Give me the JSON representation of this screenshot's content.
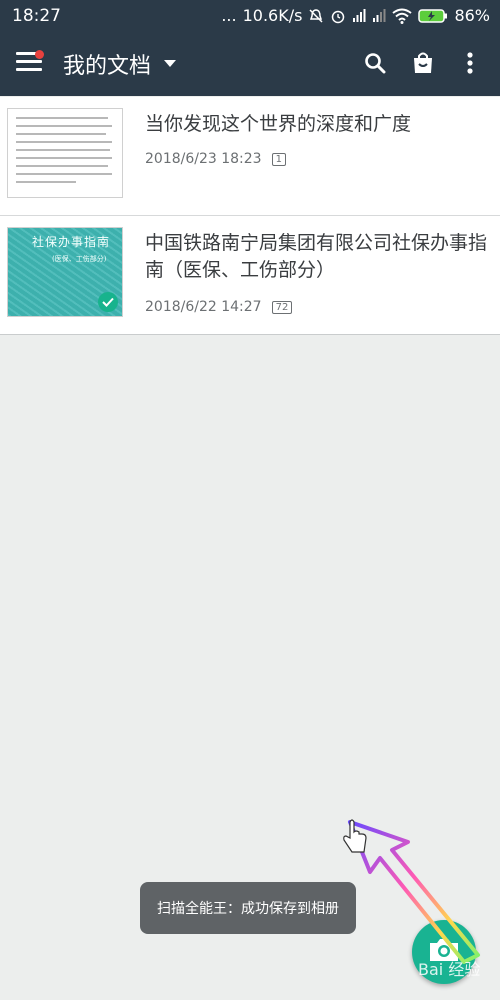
{
  "status_bar": {
    "time": "18:27",
    "dots": "...",
    "speed": "10.6K/s",
    "battery": "86%",
    "icons": [
      "mute-icon",
      "alarm-icon",
      "signal-icon",
      "signal-icon",
      "wifi-icon",
      "battery-charging-icon"
    ]
  },
  "toolbar": {
    "title": "我的文档",
    "icons": [
      "menu-icon",
      "caret-down-icon",
      "search-icon",
      "bag-icon",
      "more-vert-icon"
    ]
  },
  "documents": [
    {
      "title": "当你发现这个世界的深度和广度",
      "date": "2018/6/23 18:23",
      "pages": "1"
    },
    {
      "title": "中国铁路南宁局集团有限公司社保办事指南（医保、工伤部分）",
      "date": "2018/6/22 14:27",
      "pages": "72",
      "thumb_title": "社保办事指南",
      "thumb_subtitle": "(医保、工伤部分)"
    }
  ],
  "toast": "扫描全能王：成功保存到相册",
  "fab": {
    "icon": "camera-icon"
  },
  "colors": {
    "header": "#2b3a48",
    "accent": "#19b392",
    "background": "#eceeed",
    "badge": "#e8413e"
  }
}
